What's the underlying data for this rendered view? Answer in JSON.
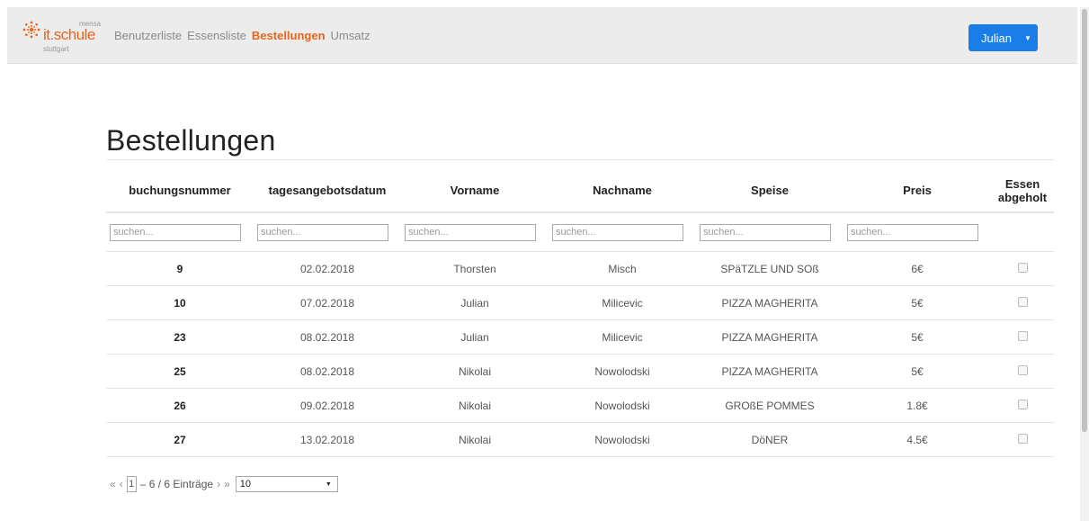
{
  "brand": {
    "name": "it.schule",
    "sub": "mensa",
    "city": "stuttgart",
    "color": "#e8661c"
  },
  "nav": [
    {
      "label": "Benutzerliste",
      "active": false
    },
    {
      "label": "Essensliste",
      "active": false
    },
    {
      "label": "Bestellungen",
      "active": true
    },
    {
      "label": "Umsatz",
      "active": false
    }
  ],
  "user": {
    "label": "Julian",
    "caret": "▼",
    "color": "#1b7ee8"
  },
  "page_title": "Bestellungen",
  "table": {
    "columns": [
      "buchungsnummer",
      "tagesangebotsdatum",
      "Vorname",
      "Nachname",
      "Speise",
      "Preis",
      "Essen abgeholt"
    ],
    "search_placeholder": "suchen...",
    "rows": [
      {
        "id": "9",
        "date": "02.02.2018",
        "first": "Thorsten",
        "last": "Misch",
        "dish": "SPäTZLE UND SOß",
        "price": "6€",
        "picked_up": false
      },
      {
        "id": "10",
        "date": "07.02.2018",
        "first": "Julian",
        "last": "Milicevic",
        "dish": "PIZZA MAGHERITA",
        "price": "5€",
        "picked_up": false
      },
      {
        "id": "23",
        "date": "08.02.2018",
        "first": "Julian",
        "last": "Milicevic",
        "dish": "PIZZA MAGHERITA",
        "price": "5€",
        "picked_up": false
      },
      {
        "id": "25",
        "date": "08.02.2018",
        "first": "Nikolai",
        "last": "Nowolodski",
        "dish": "PIZZA MAGHERITA",
        "price": "5€",
        "picked_up": false
      },
      {
        "id": "26",
        "date": "09.02.2018",
        "first": "Nikolai",
        "last": "Nowolodski",
        "dish": "GROßE POMMES",
        "price": "1.8€",
        "picked_up": false
      },
      {
        "id": "27",
        "date": "13.02.2018",
        "first": "Nikolai",
        "last": "Nowolodski",
        "dish": "DöNER",
        "price": "4.5€",
        "picked_up": false
      }
    ]
  },
  "pager": {
    "first": "«",
    "prev": "‹",
    "page": "1",
    "info": "– 6 / 6 Einträge",
    "next": "›",
    "last": "»",
    "page_size": "10"
  }
}
